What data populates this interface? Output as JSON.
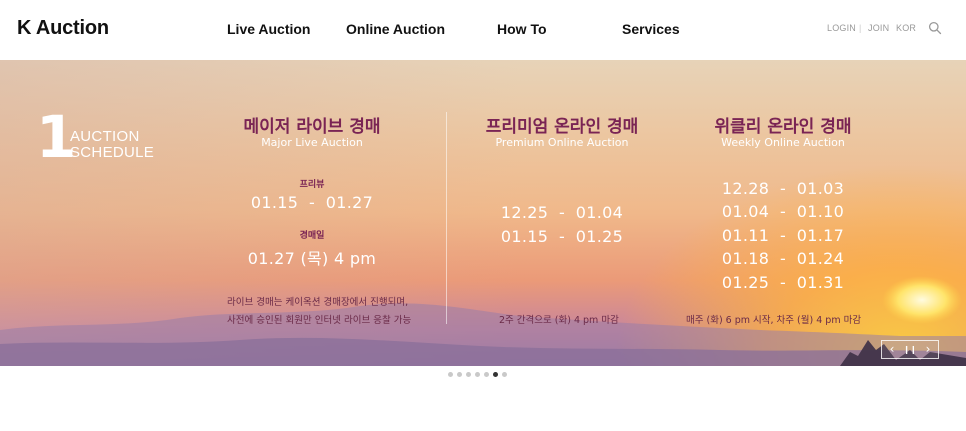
{
  "header": {
    "logo": "K Auction",
    "nav": [
      "Live Auction",
      "Online Auction",
      "How To",
      "Services"
    ],
    "utils": {
      "login": "LOGIN",
      "join": "JOIN",
      "lang": "KOR",
      "sep": "|"
    },
    "search_icon": "search-icon"
  },
  "banner": {
    "number": "1",
    "schedule_title_line1": "AUCTION",
    "schedule_title_line2": "SCHEDULE",
    "major": {
      "title": "메이저 라이브 경매",
      "subtitle": "Major Live Auction",
      "preview_label": "프리뷰",
      "preview_dates": "01.15  -  01.27",
      "auction_label": "경매일",
      "auction_date": "01.27 (목) 4 pm",
      "note_line1": "라이브 경매는 케이옥션 경매장에서 진행되며,",
      "note_line2": "사전에 승인된 회원만 인터넷 라이브 응찰 가능"
    },
    "premium": {
      "title": "프리미엄 온라인 경매",
      "subtitle": "Premium Online Auction",
      "dates": [
        "12.25  -  01.04",
        "01.15  -  01.25"
      ],
      "note": "2주 간격으로 (화) 4 pm 마감"
    },
    "weekly": {
      "title": "위클리 온라인 경매",
      "subtitle": "Weekly Online Auction",
      "dates": [
        "12.28  -  01.03",
        "01.04  -  01.10",
        "01.11  -  01.17",
        "01.18  -  01.24",
        "01.25  -  01.31"
      ],
      "note": "매주 (화) 6 pm 시작, 차주 (월) 4 pm 마감"
    },
    "controls": {
      "prev": "‹",
      "pause": "❙❙",
      "next": "›"
    }
  },
  "slider": {
    "total": 7,
    "active_index": 5
  },
  "colors": {
    "title_accent": "#7a2454",
    "text_white": "#ffffff"
  }
}
